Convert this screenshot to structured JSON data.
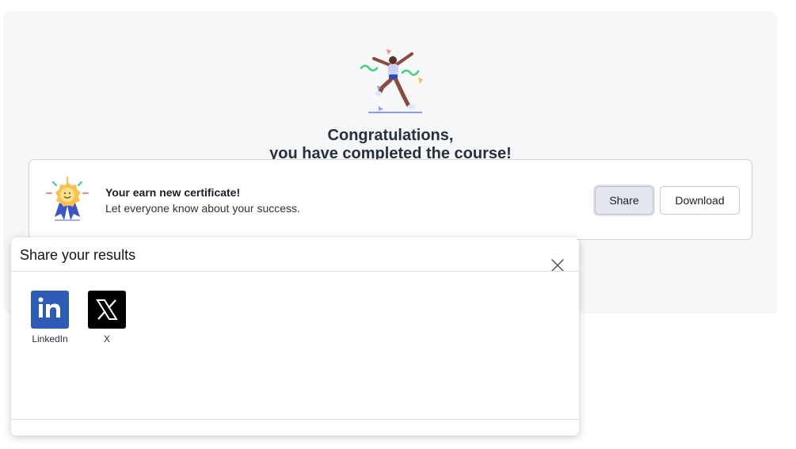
{
  "completion": {
    "title_line1": "Congratulations,",
    "title_line2": "you have completed the course!",
    "certificate": {
      "title": "Your earn new certificate!",
      "subtitle": "Let everyone know about your success.",
      "share_label": "Share",
      "download_label": "Download"
    }
  },
  "share_modal": {
    "title": "Share your results",
    "options": [
      {
        "label": "LinkedIn",
        "icon": "linkedin-icon",
        "color": "#2d5bb6"
      },
      {
        "label": "X",
        "icon": "x-logo-icon",
        "color": "#000000"
      }
    ]
  },
  "colors": {
    "panel_bg": "#f6f7f9",
    "accent_linkedin": "#2d5bb6",
    "button_active_bg": "#e4e8ee"
  }
}
